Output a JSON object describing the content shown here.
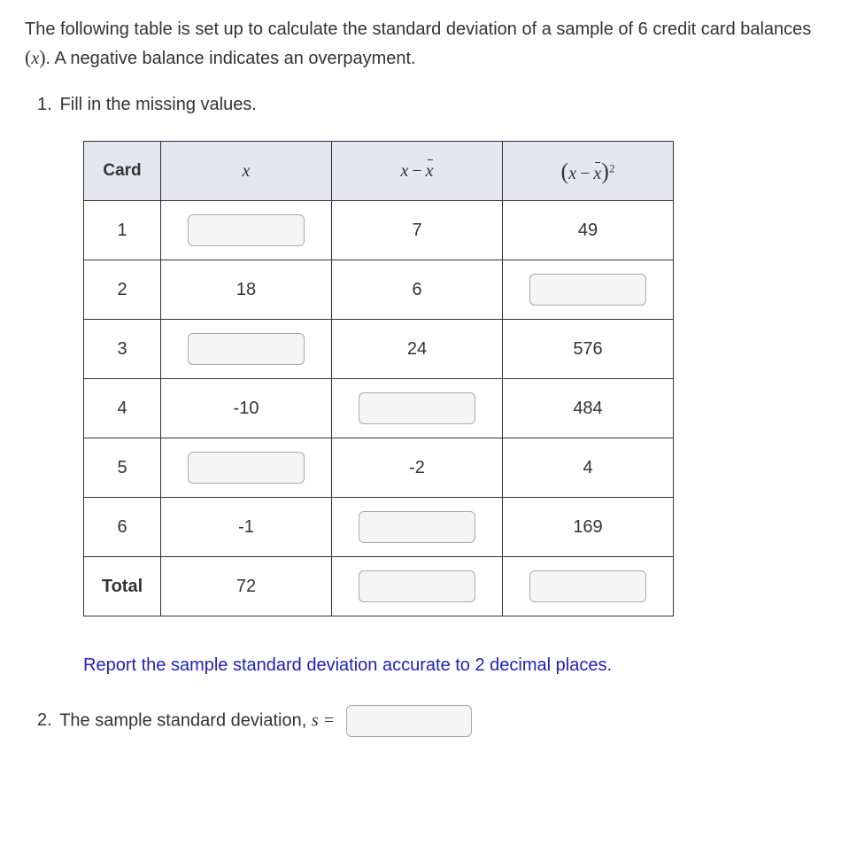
{
  "intro_part1": "The following table is set up to calculate the standard deviation of a sample of 6 credit card balances ",
  "intro_var": "x",
  "intro_part2": ". A negative balance indicates an overpayment.",
  "q1_num": "1.",
  "q1_text": "Fill in the missing values.",
  "headers": {
    "card": "Card",
    "x": "x",
    "dev_lp": "(",
    "dev_rp": ")"
  },
  "rows": [
    {
      "card": "1",
      "x": "",
      "dev": "7",
      "sq": "49",
      "x_input": true
    },
    {
      "card": "2",
      "x": "18",
      "dev": "6",
      "sq": "",
      "sq_input": true
    },
    {
      "card": "3",
      "x": "",
      "dev": "24",
      "sq": "576",
      "x_input": true
    },
    {
      "card": "4",
      "x": "-10",
      "dev": "",
      "sq": "484",
      "dev_input": true
    },
    {
      "card": "5",
      "x": "",
      "dev": "-2",
      "sq": "4",
      "x_input": true
    },
    {
      "card": "6",
      "x": "-1",
      "dev": "",
      "sq": "169",
      "dev_input": true
    }
  ],
  "total_label": "Total",
  "total_x": "72",
  "hint": "Report the sample standard deviation accurate to 2 decimal places.",
  "q2_num": "2.",
  "q2_text": "The sample standard deviation, ",
  "q2_var": "s",
  "q2_eq": " = "
}
